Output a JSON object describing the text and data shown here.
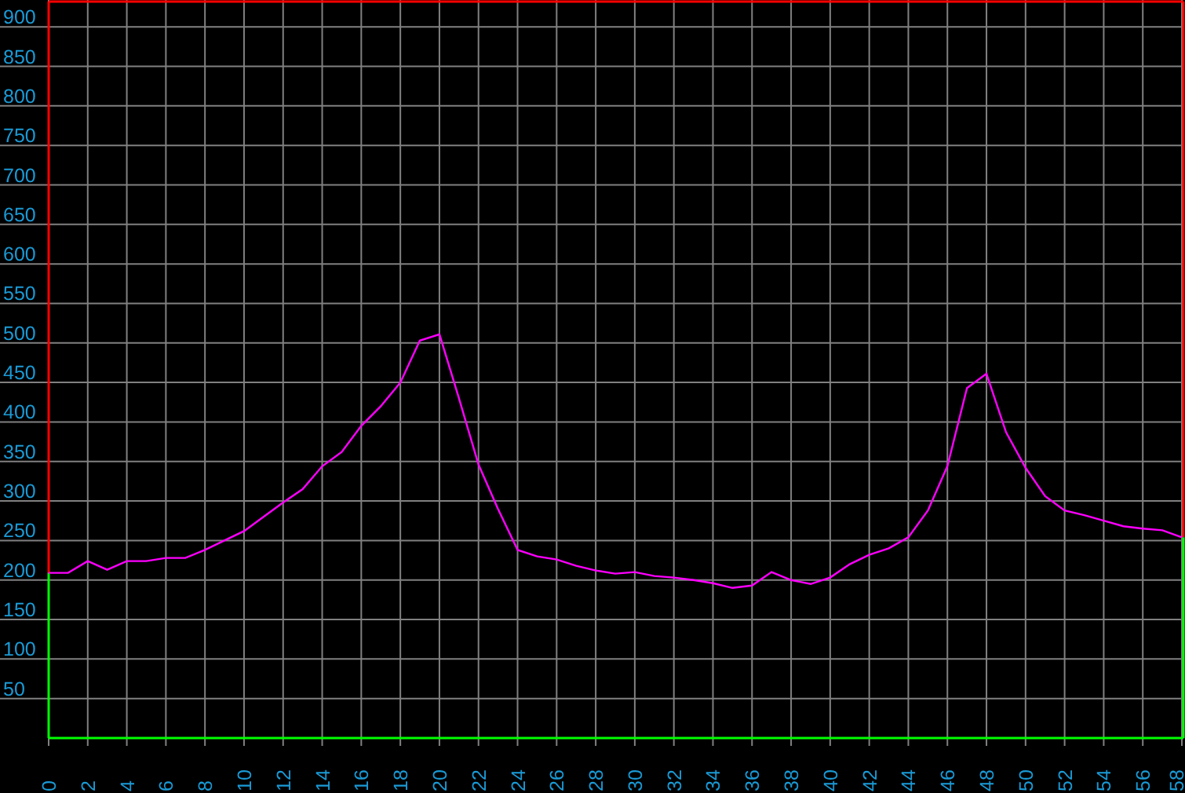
{
  "chart": {
    "chart_data": {
      "type": "line",
      "x": [
        0,
        1,
        2,
        3,
        4,
        5,
        6,
        7,
        8,
        9,
        10,
        11,
        12,
        13,
        14,
        15,
        16,
        17,
        18,
        19,
        20,
        21,
        22,
        23,
        24,
        25,
        26,
        27,
        28,
        29,
        30,
        31,
        32,
        33,
        34,
        35,
        36,
        37,
        38,
        39,
        40,
        41,
        42,
        43,
        44,
        45,
        46,
        47,
        48,
        49,
        50,
        51,
        52,
        53,
        54,
        55,
        56,
        57,
        58
      ],
      "grid": true,
      "series": [
        {
          "color": "#ff00ff",
          "values": [
            209,
            209,
            224,
            213,
            224,
            224,
            228,
            228,
            238,
            250,
            262,
            280,
            298,
            315,
            344,
            362,
            395,
            420,
            450,
            503,
            511,
            430,
            346,
            290,
            238,
            230,
            226,
            218,
            212,
            208,
            210,
            205,
            203,
            200,
            196,
            190,
            193,
            210,
            200,
            195,
            203,
            220,
            232,
            240,
            254,
            288,
            344,
            443,
            461,
            387,
            342,
            306,
            288,
            282,
            275,
            268,
            265,
            263,
            254
          ]
        }
      ],
      "xlim": [
        0,
        58
      ],
      "ylim": [
        0,
        934
      ],
      "xticks": [
        0,
        2,
        4,
        6,
        8,
        10,
        12,
        14,
        16,
        18,
        20,
        22,
        24,
        26,
        28,
        30,
        32,
        34,
        36,
        38,
        40,
        42,
        44,
        46,
        48,
        50,
        52,
        54,
        56,
        58
      ],
      "yticks": [
        50,
        100,
        150,
        200,
        250,
        300,
        350,
        400,
        450,
        500,
        550,
        600,
        650,
        700,
        750,
        800,
        850,
        900
      ]
    }
  }
}
